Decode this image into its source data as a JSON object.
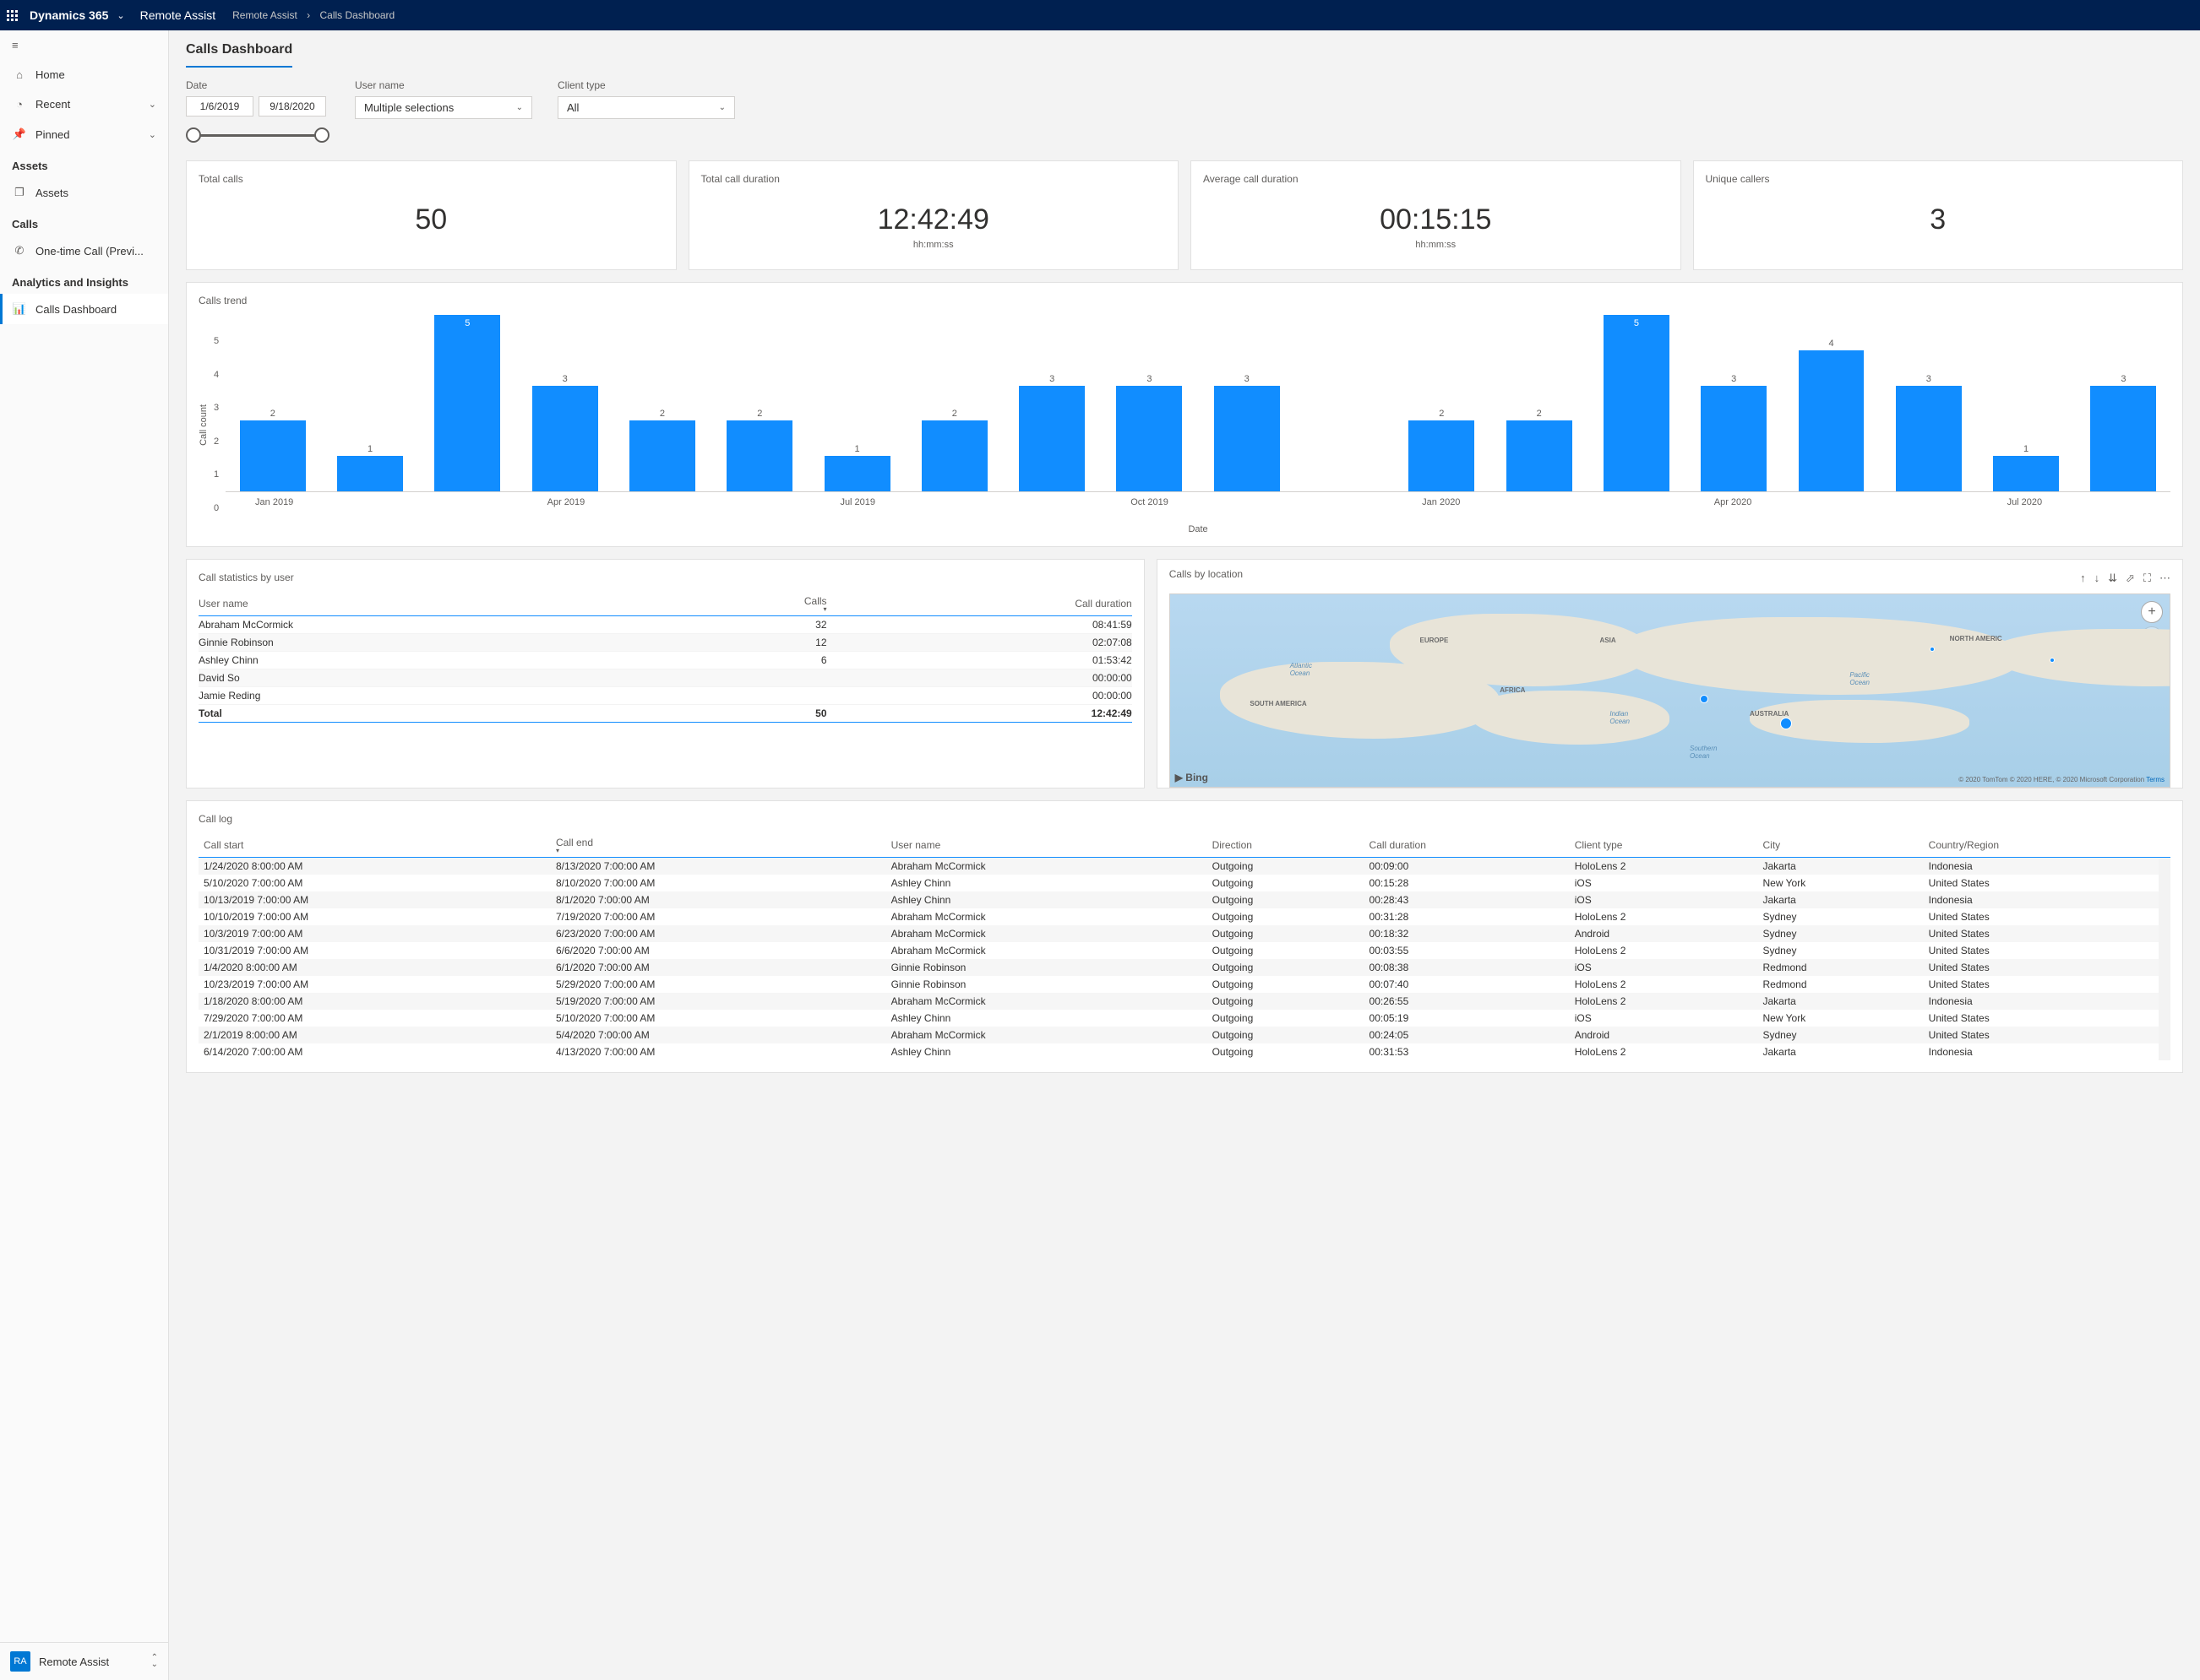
{
  "header": {
    "brand": "Dynamics 365",
    "app": "Remote Assist",
    "breadcrumb": [
      "Remote Assist",
      "Calls Dashboard"
    ]
  },
  "sidebar": {
    "top": [
      {
        "icon": "home",
        "label": "Home"
      },
      {
        "icon": "clock",
        "label": "Recent",
        "chevron": true
      },
      {
        "icon": "pin",
        "label": "Pinned",
        "chevron": true
      }
    ],
    "groups": [
      {
        "title": "Assets",
        "items": [
          {
            "icon": "cube",
            "label": "Assets"
          }
        ]
      },
      {
        "title": "Calls",
        "items": [
          {
            "icon": "phone",
            "label": "One-time Call (Previ..."
          }
        ]
      },
      {
        "title": "Analytics and Insights",
        "items": [
          {
            "icon": "chart",
            "label": "Calls Dashboard",
            "active": true
          }
        ]
      }
    ],
    "footer": {
      "badge": "RA",
      "label": "Remote Assist"
    }
  },
  "page": {
    "title": "Calls Dashboard"
  },
  "filters": {
    "date": {
      "label": "Date",
      "from": "1/6/2019",
      "to": "9/18/2020"
    },
    "username": {
      "label": "User name",
      "value": "Multiple selections"
    },
    "clienttype": {
      "label": "Client type",
      "value": "All"
    }
  },
  "kpis": [
    {
      "title": "Total calls",
      "value": "50"
    },
    {
      "title": "Total call duration",
      "value": "12:42:49",
      "sub": "hh:mm:ss"
    },
    {
      "title": "Average call duration",
      "value": "00:15:15",
      "sub": "hh:mm:ss"
    },
    {
      "title": "Unique callers",
      "value": "3"
    }
  ],
  "chart_data": {
    "type": "bar",
    "title": "Calls trend",
    "ylabel": "Call count",
    "xlabel": "Date",
    "ylim": [
      0,
      5
    ],
    "yticks": [
      5,
      4,
      3,
      2,
      1,
      0
    ],
    "categories": [
      "Jan 2019",
      "Feb 2019",
      "Mar 2019",
      "Apr 2019",
      "May 2019",
      "Jun 2019",
      "Jul 2019",
      "Aug 2019",
      "Sep 2019",
      "Oct 2019",
      "Nov 2019",
      "Dec 2019",
      "Jan 2020",
      "Feb 2020",
      "Mar 2020",
      "Apr 2020",
      "May 2020",
      "Jun 2020",
      "Jul 2020",
      "Aug 2020"
    ],
    "values": [
      2,
      1,
      5,
      3,
      2,
      2,
      1,
      2,
      3,
      3,
      3,
      null,
      2,
      2,
      5,
      3,
      4,
      3,
      1,
      3
    ],
    "xtick_labels": [
      {
        "pos_pct": 2.5,
        "text": "Jan 2019"
      },
      {
        "pos_pct": 17.5,
        "text": "Apr 2019"
      },
      {
        "pos_pct": 32.5,
        "text": "Jul 2019"
      },
      {
        "pos_pct": 47.5,
        "text": "Oct 2019"
      },
      {
        "pos_pct": 62.5,
        "text": "Jan 2020"
      },
      {
        "pos_pct": 77.5,
        "text": "Apr 2020"
      },
      {
        "pos_pct": 92.5,
        "text": "Jul 2020"
      }
    ]
  },
  "stats": {
    "title": "Call statistics by user",
    "columns": [
      "User name",
      "Calls",
      "Call duration"
    ],
    "rows": [
      {
        "user": "Abraham McCormick",
        "calls": "32",
        "duration": "08:41:59"
      },
      {
        "user": "Ginnie Robinson",
        "calls": "12",
        "duration": "02:07:08"
      },
      {
        "user": "Ashley Chinn",
        "calls": "6",
        "duration": "01:53:42"
      },
      {
        "user": "David So",
        "calls": "",
        "duration": "00:00:00"
      },
      {
        "user": "Jamie Reding",
        "calls": "",
        "duration": "00:00:00"
      }
    ],
    "total": {
      "label": "Total",
      "calls": "50",
      "duration": "12:42:49"
    }
  },
  "map": {
    "title": "Calls by location",
    "bing": "Bing",
    "attribution": "© 2020 TomTom © 2020 HERE, © 2020 Microsoft Corporation",
    "terms": "Terms",
    "labels": [
      "EUROPE",
      "ASIA",
      "NORTH AMERIC",
      "AFRICA",
      "SOUTH AMERICA",
      "AUSTRALIA"
    ],
    "oceans": [
      "Atlantic Ocean",
      "Indian Ocean",
      "Pacific Ocean",
      "Southern Ocean"
    ],
    "points": [
      {
        "x": 53,
        "y": 52,
        "size": 10
      },
      {
        "x": 61,
        "y": 64,
        "size": 14
      },
      {
        "x": 76,
        "y": 27,
        "size": 6
      },
      {
        "x": 88,
        "y": 33,
        "size": 6
      }
    ]
  },
  "log": {
    "title": "Call log",
    "columns": [
      "Call start",
      "Call end",
      "User name",
      "Direction",
      "Call duration",
      "Client type",
      "City",
      "Country/Region"
    ],
    "rows": [
      {
        "c": [
          "1/24/2020 8:00:00 AM",
          "8/13/2020 7:00:00 AM",
          "Abraham McCormick",
          "Outgoing",
          "00:09:00",
          "HoloLens 2",
          "Jakarta",
          "Indonesia"
        ]
      },
      {
        "c": [
          "5/10/2020 7:00:00 AM",
          "8/10/2020 7:00:00 AM",
          "Ashley Chinn",
          "Outgoing",
          "00:15:28",
          "iOS",
          "New York",
          "United States"
        ]
      },
      {
        "c": [
          "10/13/2019 7:00:00 AM",
          "8/1/2020 7:00:00 AM",
          "Ashley Chinn",
          "Outgoing",
          "00:28:43",
          "iOS",
          "Jakarta",
          "Indonesia"
        ]
      },
      {
        "c": [
          "10/10/2019 7:00:00 AM",
          "7/19/2020 7:00:00 AM",
          "Abraham McCormick",
          "Outgoing",
          "00:31:28",
          "HoloLens 2",
          "Sydney",
          "United States"
        ]
      },
      {
        "c": [
          "10/3/2019 7:00:00 AM",
          "6/23/2020 7:00:00 AM",
          "Abraham McCormick",
          "Outgoing",
          "00:18:32",
          "Android",
          "Sydney",
          "United States"
        ]
      },
      {
        "c": [
          "10/31/2019 7:00:00 AM",
          "6/6/2020 7:00:00 AM",
          "Abraham McCormick",
          "Outgoing",
          "00:03:55",
          "HoloLens 2",
          "Sydney",
          "United States"
        ]
      },
      {
        "c": [
          "1/4/2020 8:00:00 AM",
          "6/1/2020 7:00:00 AM",
          "Ginnie Robinson",
          "Outgoing",
          "00:08:38",
          "iOS",
          "Redmond",
          "United States"
        ]
      },
      {
        "c": [
          "10/23/2019 7:00:00 AM",
          "5/29/2020 7:00:00 AM",
          "Ginnie Robinson",
          "Outgoing",
          "00:07:40",
          "HoloLens 2",
          "Redmond",
          "United States"
        ]
      },
      {
        "c": [
          "1/18/2020 8:00:00 AM",
          "5/19/2020 7:00:00 AM",
          "Abraham McCormick",
          "Outgoing",
          "00:26:55",
          "HoloLens 2",
          "Jakarta",
          "Indonesia"
        ]
      },
      {
        "c": [
          "7/29/2020 7:00:00 AM",
          "5/10/2020 7:00:00 AM",
          "Ashley Chinn",
          "Outgoing",
          "00:05:19",
          "iOS",
          "New York",
          "United States"
        ]
      },
      {
        "c": [
          "2/1/2019 8:00:00 AM",
          "5/4/2020 7:00:00 AM",
          "Abraham McCormick",
          "Outgoing",
          "00:24:05",
          "Android",
          "Sydney",
          "United States"
        ]
      },
      {
        "c": [
          "6/14/2020 7:00:00 AM",
          "4/13/2020 7:00:00 AM",
          "Ashley Chinn",
          "Outgoing",
          "00:31:53",
          "HoloLens 2",
          "Jakarta",
          "Indonesia"
        ]
      }
    ]
  }
}
